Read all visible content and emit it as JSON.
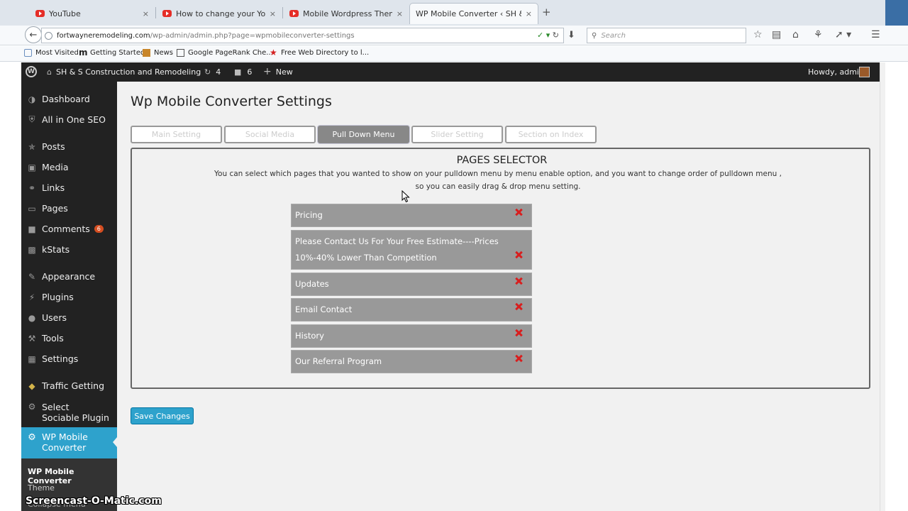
{
  "browser": {
    "tabs": [
      {
        "title": "YouTube",
        "active": false
      },
      {
        "title": "How to change your YouT...",
        "active": false
      },
      {
        "title": "Mobile Wordpress Theme ...",
        "active": false
      },
      {
        "title": "WP Mobile Converter ‹ SH & S ...",
        "active": true
      }
    ],
    "tab_close_glyph": "×",
    "new_tab_glyph": "+",
    "url_domain": "fortwayneremodeling.com",
    "url_path": "/wp-admin/admin.php?page=wpmobileconverter-settings",
    "search_placeholder": "Search",
    "bookmarks": [
      "Most Visited",
      "Getting Started",
      "News",
      "Google PageRank Che...",
      "Free Web Directory to l..."
    ]
  },
  "adminbar": {
    "site_name": "SH & S Construction and Remodeling",
    "updates_count": "4",
    "comments_count": "6",
    "new_label": "New",
    "howdy": "Howdy, admin"
  },
  "sidebar": {
    "items": [
      {
        "label": "Dashboard",
        "icon": "dashboard-icon"
      },
      {
        "label": "All in One SEO",
        "icon": "shield-icon"
      },
      {
        "label": "Posts",
        "icon": "pin-icon"
      },
      {
        "label": "Media",
        "icon": "media-icon"
      },
      {
        "label": "Links",
        "icon": "link-icon"
      },
      {
        "label": "Pages",
        "icon": "page-icon"
      },
      {
        "label": "Comments",
        "icon": "comment-icon",
        "badge": "6"
      },
      {
        "label": "kStats",
        "icon": "chart-icon"
      },
      {
        "label": "Appearance",
        "icon": "brush-icon"
      },
      {
        "label": "Plugins",
        "icon": "plug-icon"
      },
      {
        "label": "Users",
        "icon": "user-icon"
      },
      {
        "label": "Tools",
        "icon": "wrench-icon"
      },
      {
        "label": "Settings",
        "icon": "settings-icon"
      },
      {
        "label": "Traffic Getting",
        "icon": "diamond-icon"
      },
      {
        "label": "Select Sociable Plugin",
        "icon": "gear-icon"
      }
    ],
    "current": {
      "label": "WP Mobile Converter",
      "icon": "gear-icon"
    },
    "submenu": [
      "WP Mobile Converter",
      "Theme",
      "Collapse menu"
    ]
  },
  "page": {
    "title": "Wp Mobile Converter Settings",
    "tabs": [
      "Main Setting",
      "Social Media",
      "Pull Down Menu",
      "Slider Setting",
      "Section on Index"
    ],
    "active_tab": "Pull Down Menu",
    "selector_title": "PAGES SELECTOR",
    "selector_desc_line1": "You can select which pages that you wanted to show on your pulldown menu by menu enable option, and you want to change order of pulldown menu ,",
    "selector_desc_line2": "so you can easily drag & drop menu setting.",
    "pages": [
      {
        "line1": "Pricing",
        "line2": ""
      },
      {
        "line1": "Please Contact Us For Your Free Estimate----Prices",
        "line2": "10%-40% Lower Than Competition"
      },
      {
        "line1": "Updates",
        "line2": ""
      },
      {
        "line1": "Email Contact",
        "line2": ""
      },
      {
        "line1": "History",
        "line2": ""
      },
      {
        "line1": "Our Referral Program",
        "line2": ""
      }
    ],
    "save_label": "Save Changes"
  },
  "watermark": "Screencast-O-Matic.com",
  "colors": {
    "admin_dark": "#222222",
    "accent_blue": "#2ea2cc",
    "badge_orange": "#d54e21",
    "page_item_gray": "#999999",
    "remove_red": "#d81e1e"
  }
}
